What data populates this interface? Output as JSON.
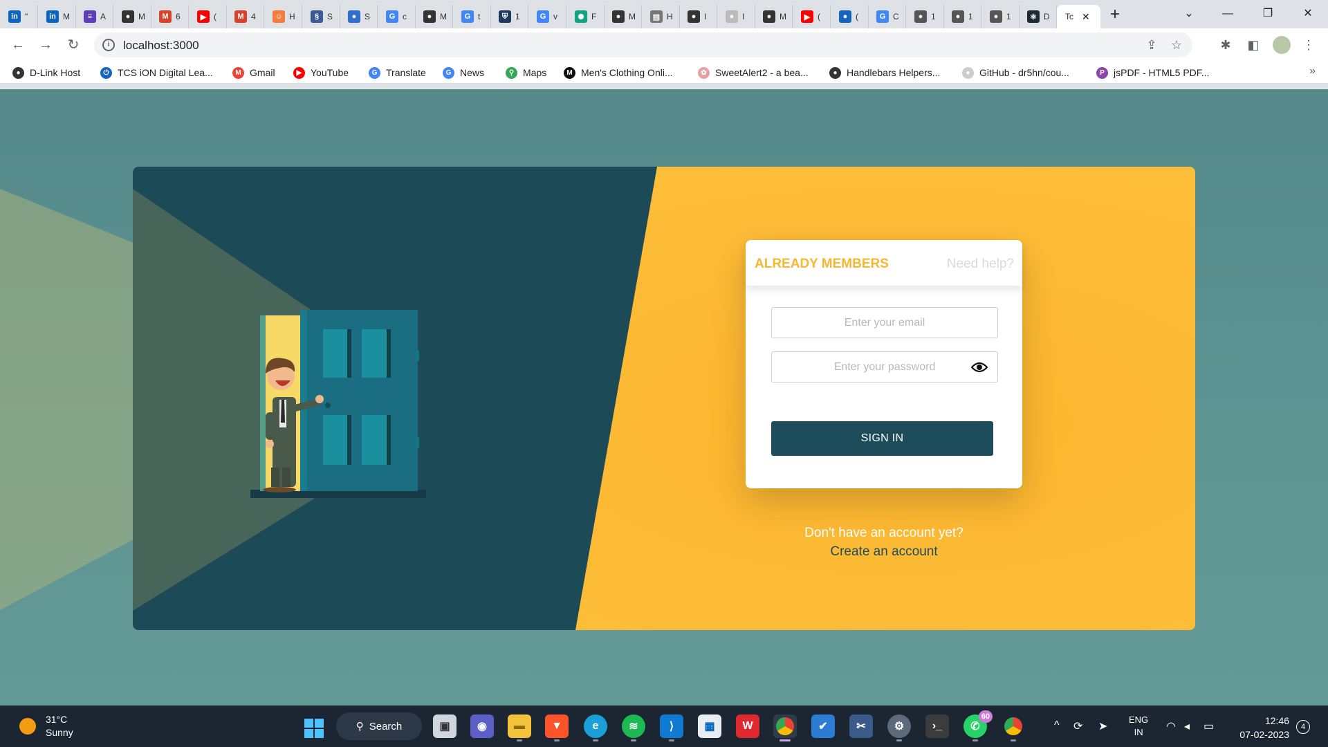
{
  "browser": {
    "tabs": [
      {
        "icon": "linkedin-icon",
        "color": "#0a66c2",
        "glyph": "in",
        "text": "\""
      },
      {
        "icon": "linkedin-icon",
        "color": "#0a66c2",
        "glyph": "in",
        "text": "M"
      },
      {
        "icon": "list-icon",
        "color": "#5c3fb8",
        "glyph": "≡",
        "text": "A"
      },
      {
        "icon": "github-icon",
        "color": "#333333",
        "glyph": "●",
        "text": "M"
      },
      {
        "icon": "m-logo-icon",
        "color": "#d9412a",
        "glyph": "M",
        "text": "6"
      },
      {
        "icon": "youtube-icon",
        "color": "#ff0000",
        "glyph": "▶",
        "text": "("
      },
      {
        "icon": "m-logo-icon",
        "color": "#d9412a",
        "glyph": "M",
        "text": "4"
      },
      {
        "icon": "app-icon",
        "color": "#f47c3c",
        "glyph": "☺",
        "text": "H"
      },
      {
        "icon": "app-icon",
        "color": "#3b5998",
        "glyph": "§",
        "text": "S"
      },
      {
        "icon": "app-icon",
        "color": "#2f6fd1",
        "glyph": "●",
        "text": "S"
      },
      {
        "icon": "google-icon",
        "color": "#4285f4",
        "glyph": "G",
        "text": "c"
      },
      {
        "icon": "github-icon",
        "color": "#333333",
        "glyph": "●",
        "text": "M"
      },
      {
        "icon": "google-icon",
        "color": "#4285f4",
        "glyph": "G",
        "text": "t"
      },
      {
        "icon": "shield-icon",
        "color": "#1e3a5f",
        "glyph": "⛨",
        "text": "1"
      },
      {
        "icon": "google-icon",
        "color": "#4285f4",
        "glyph": "G",
        "text": "v"
      },
      {
        "icon": "chatgpt-icon",
        "color": "#10a37f",
        "glyph": "✺",
        "text": "F"
      },
      {
        "icon": "github-icon",
        "color": "#333333",
        "glyph": "●",
        "text": "M"
      },
      {
        "icon": "doc-icon",
        "color": "#777777",
        "glyph": "▤",
        "text": "H"
      },
      {
        "icon": "globe-icon",
        "color": "#333333",
        "glyph": "●",
        "text": "I"
      },
      {
        "icon": "globe-icon",
        "color": "#bbbbbb",
        "glyph": "●",
        "text": "I"
      },
      {
        "icon": "github-icon",
        "color": "#333333",
        "glyph": "●",
        "text": "M"
      },
      {
        "icon": "youtube-icon",
        "color": "#ff0000",
        "glyph": "▶",
        "text": "("
      },
      {
        "icon": "app-icon",
        "color": "#1565c0",
        "glyph": "●",
        "text": "("
      },
      {
        "icon": "translate-icon",
        "color": "#4285f4",
        "glyph": "G",
        "text": "C"
      },
      {
        "icon": "globe-icon",
        "color": "#555555",
        "glyph": "●",
        "text": "1"
      },
      {
        "icon": "globe-icon",
        "color": "#555555",
        "glyph": "●",
        "text": "1"
      },
      {
        "icon": "globe-icon",
        "color": "#555555",
        "glyph": "●",
        "text": "1"
      },
      {
        "icon": "react-icon",
        "color": "#1e2a33",
        "glyph": "⚛",
        "text": "D"
      }
    ],
    "active_tab": {
      "text": "Tc",
      "close": "✕"
    },
    "new_tab": "+",
    "window_controls": {
      "dropdown": "⌄",
      "minimize": "—",
      "restore": "❐",
      "close": "✕"
    },
    "url": "localhost:3000",
    "bookmarks": [
      {
        "label": "D-Link Host",
        "icon": "globe-icon",
        "color": "#333333",
        "glyph": "●"
      },
      {
        "label": "TCS iON Digital Lea...",
        "icon": "power-icon",
        "color": "#1565c0",
        "glyph": "⏻"
      },
      {
        "label": "Gmail",
        "icon": "gmail-icon",
        "color": "#ea4335",
        "glyph": "M"
      },
      {
        "label": "YouTube",
        "icon": "youtube-icon",
        "color": "#ff0000",
        "glyph": "▶"
      },
      {
        "label": "Translate",
        "icon": "translate-icon",
        "color": "#4285f4",
        "glyph": "G"
      },
      {
        "label": "News",
        "icon": "news-icon",
        "color": "#4285f4",
        "glyph": "G"
      },
      {
        "label": "Maps",
        "icon": "maps-icon",
        "color": "#34a853",
        "glyph": "⚲"
      },
      {
        "label": "Men's Clothing Onli...",
        "icon": "store-icon",
        "color": "#111111",
        "glyph": "M"
      },
      {
        "label": "SweetAlert2 - a bea...",
        "icon": "sweetalert-icon",
        "color": "#e8a0a0",
        "glyph": "✿"
      },
      {
        "label": "Handlebars Helpers...",
        "icon": "globe-icon",
        "color": "#333333",
        "glyph": "●"
      },
      {
        "label": "GitHub - dr5hn/cou...",
        "icon": "github-icon",
        "color": "#cccccc",
        "glyph": "●"
      },
      {
        "label": "jsPDF - HTML5 PDF...",
        "icon": "jspdf-icon",
        "color": "#8e44ad",
        "glyph": "P"
      }
    ],
    "bookmarks_more": "»"
  },
  "login": {
    "title": "ALREADY MEMBERS",
    "help": "Need help?",
    "email_placeholder": "Enter your email",
    "email_value": "",
    "password_placeholder": "Enter your password",
    "password_value": "",
    "signin": "SIGN IN",
    "no_account": "Don't have an account yet?",
    "create": "Create an account"
  },
  "taskbar": {
    "weather_temp": "31°C",
    "weather_desc": "Sunny",
    "search": "Search",
    "whatsapp_badge": "60",
    "lang_1": "ENG",
    "lang_2": "IN",
    "time": "12:46",
    "date": "07-02-2023",
    "notifications": "4"
  },
  "colors": {
    "page_bg": "#5e9593",
    "dark_panel": "#1d4d5b",
    "accent_yellow": "#fcb935",
    "button": "#1d4d5b"
  }
}
